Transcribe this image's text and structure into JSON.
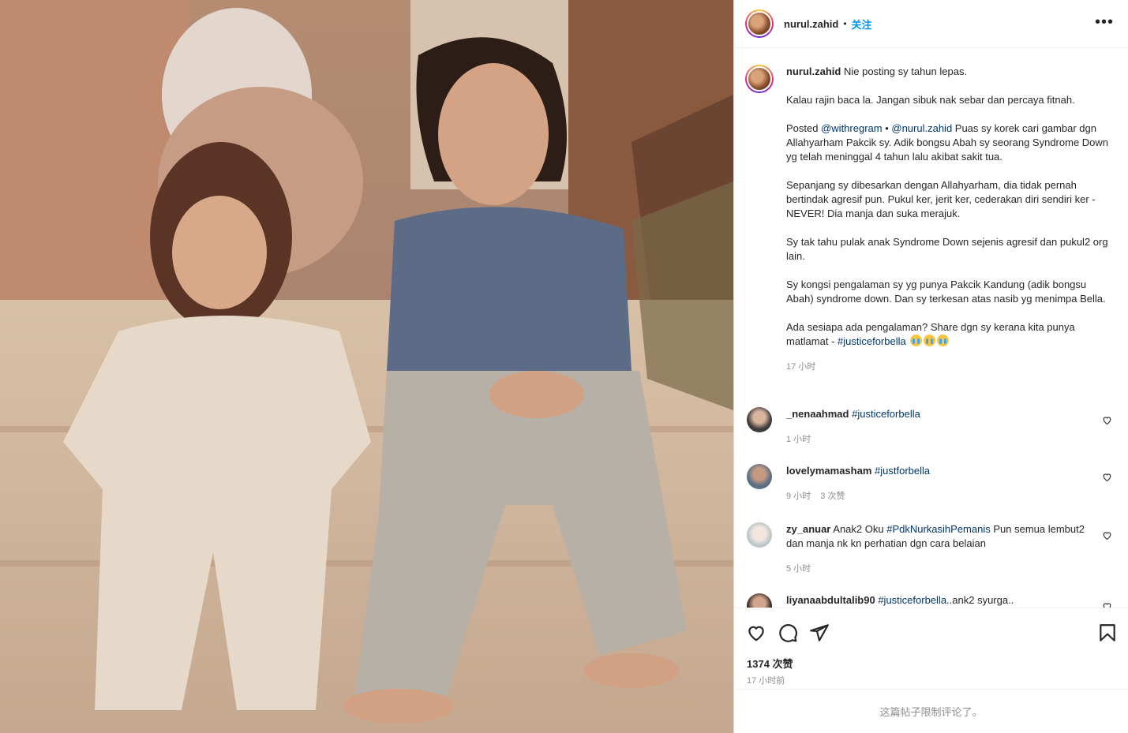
{
  "post": {
    "username": "nurul.zahid",
    "follow_label": "关注",
    "more_icon": "more-horizontal-icon"
  },
  "caption": {
    "username": "nurul.zahid",
    "line1": "Nie posting sy tahun lepas.",
    "p2": "Kalau rajin baca la. Jangan sibuk nak sebar dan percaya fitnah.",
    "p3_prefix": "Posted ",
    "p3_mention1": "@withregram",
    "p3_sep": " • ",
    "p3_mention2": "@nurul.zahid",
    "p3_rest": " Puas sy korek cari gambar dgn Allahyarham Pakcik sy. Adik bongsu Abah sy seorang Syndrome Down yg telah meninggal 4 tahun lalu akibat sakit tua.",
    "p4": "Sepanjang sy dibesarkan dengan Allahyarham, dia tidak pernah bertindak agresif pun. Pukul ker, jerit ker, cederakan diri sendiri ker - NEVER! Dia manja dan suka merajuk.",
    "p5": "Sy tak tahu pulak anak Syndrome Down sejenis agresif dan pukul2 org lain.",
    "p6": "Sy kongsi pengalaman sy yg punya Pakcik Kandung (adik bongsu Abah) syndrome down. Dan sy terkesan atas nasib yg menimpa Bella.",
    "p7_text": "Ada sesiapa ada pengalaman? Share dgn sy kerana kita punya matlamat - ",
    "p7_hashtag": "#justiceforbella",
    "time": "17 小时"
  },
  "comments": [
    {
      "user": "_nenaahmad",
      "hashtag": "#justiceforbella",
      "text": "",
      "time": "1 小时",
      "likes": ""
    },
    {
      "user": "lovelymamasham",
      "hashtag": "#justforbella",
      "text": "",
      "time": "9 小时",
      "likes": "3 次赞"
    },
    {
      "user": "zy_anuar",
      "pre": "Anak2 Oku ",
      "hashtag": "#PdkNurkasihPemanis",
      "text": " Pun semua lembut2 dan manja nk kn perhatian dgn cara belaian",
      "time": "5 小时",
      "likes": ""
    },
    {
      "user": "liyanaabdultalib90",
      "hashtag": "#justiceforbella",
      "text": "..ank2 syurga..",
      "time": "",
      "likes": ""
    }
  ],
  "actions": {
    "likes": "1374 次赞",
    "date": "17 小时前"
  },
  "footer": {
    "text": "这篇帖子限制评论了。"
  },
  "colors": {
    "link": "#00376b",
    "follow": "#0095f6",
    "muted": "#8e8e8e"
  }
}
